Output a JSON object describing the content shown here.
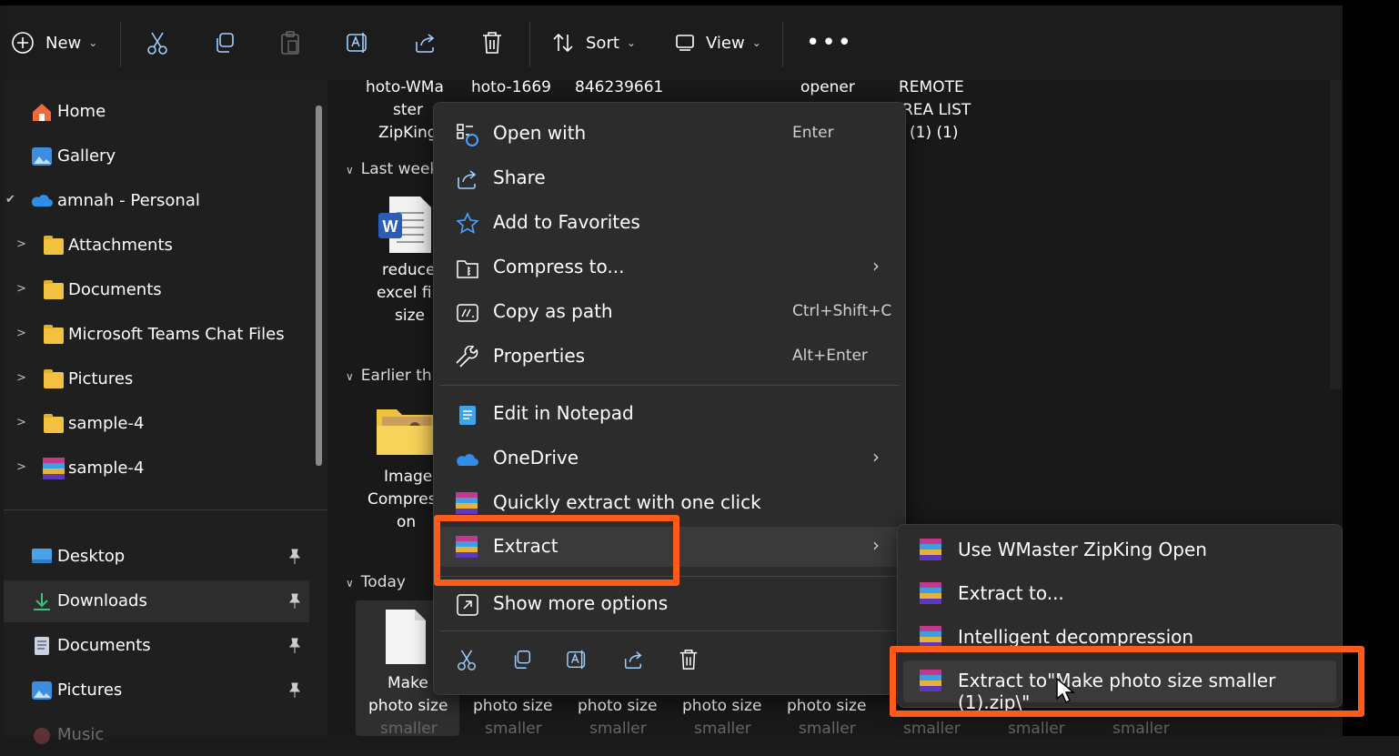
{
  "toolbar": {
    "new_label": "New",
    "sort_label": "Sort",
    "view_label": "View"
  },
  "sidebar": {
    "items": [
      {
        "label": "Home",
        "icon": "home-icon"
      },
      {
        "label": "Gallery",
        "icon": "gallery-icon"
      },
      {
        "label": "amnah - Personal",
        "icon": "onedrive-icon"
      },
      {
        "label": "Attachments",
        "icon": "folder-icon"
      },
      {
        "label": "Documents",
        "icon": "folder-icon"
      },
      {
        "label": "Microsoft Teams Chat Files",
        "icon": "folder-icon"
      },
      {
        "label": "Pictures",
        "icon": "folder-icon"
      },
      {
        "label": "sample-4",
        "icon": "folder-icon"
      },
      {
        "label": "sample-4",
        "icon": "archive-icon"
      }
    ],
    "quick_access": [
      {
        "label": "Desktop",
        "icon": "desktop-icon"
      },
      {
        "label": "Downloads",
        "icon": "download-icon"
      },
      {
        "label": "Documents",
        "icon": "documents-icon"
      },
      {
        "label": "Pictures",
        "icon": "pictures-icon"
      },
      {
        "label": "Music",
        "icon": "music-icon"
      }
    ]
  },
  "files": {
    "top_row": [
      "hoto-WMa",
      "ster",
      "ZipKing",
      "hoto-1669",
      "846239661",
      "opener",
      "REMOTE",
      "REA LIST",
      "(1) (1)"
    ],
    "groups": [
      "Last week",
      "Earlier this",
      "Today"
    ],
    "last_week_file": [
      "reduce",
      "excel fil",
      "size"
    ],
    "earlier_file": [
      "Image",
      "Compres",
      "on"
    ],
    "today_file": [
      "Make",
      "photo size"
    ],
    "bottom_names": [
      "photo size",
      "photo size",
      "photo size",
      "photo size"
    ],
    "bottom_sub": "smaller"
  },
  "context_menu": {
    "items": [
      {
        "label": "Open with",
        "shortcut": "Enter"
      },
      {
        "label": "Share"
      },
      {
        "label": "Add to Favorites"
      },
      {
        "label": "Compress to..."
      },
      {
        "label": "Copy as path",
        "shortcut": "Ctrl+Shift+C"
      },
      {
        "label": "Properties",
        "shortcut": "Alt+Enter"
      },
      {
        "label": "Edit in Notepad"
      },
      {
        "label": "OneDrive"
      },
      {
        "label": "Quickly extract with one click"
      },
      {
        "label": "Extract"
      },
      {
        "label": "Show more options"
      }
    ]
  },
  "submenu": {
    "items": [
      {
        "label": "Use WMaster ZipKing Open"
      },
      {
        "label": "Extract to..."
      },
      {
        "label": "Intelligent decompression"
      },
      {
        "label": "Extract to\"Make photo size smaller (1).zip\\\""
      }
    ]
  },
  "colors": {
    "highlight": "#ff5a1a",
    "menu_bg": "#2c2c2c",
    "accent_blue": "#4aa3ff"
  }
}
